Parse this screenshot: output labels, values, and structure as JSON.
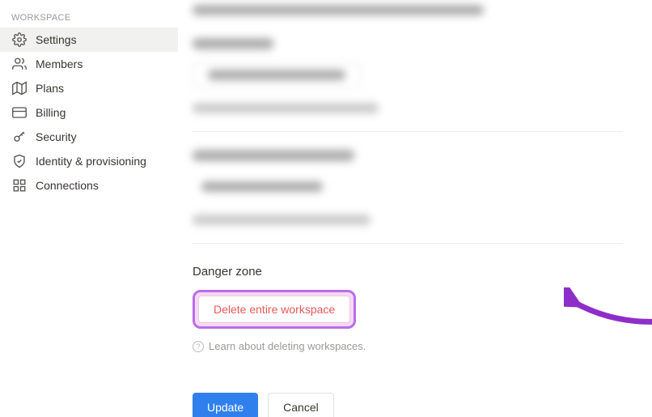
{
  "sidebar": {
    "header": "WORKSPACE",
    "items": [
      {
        "label": "Settings"
      },
      {
        "label": "Members"
      },
      {
        "label": "Plans"
      },
      {
        "label": "Billing"
      },
      {
        "label": "Security"
      },
      {
        "label": "Identity & provisioning"
      },
      {
        "label": "Connections"
      }
    ]
  },
  "danger": {
    "title": "Danger zone",
    "delete_label": "Delete entire workspace",
    "learn_label": "Learn about deleting workspaces."
  },
  "footer": {
    "update": "Update",
    "cancel": "Cancel"
  }
}
